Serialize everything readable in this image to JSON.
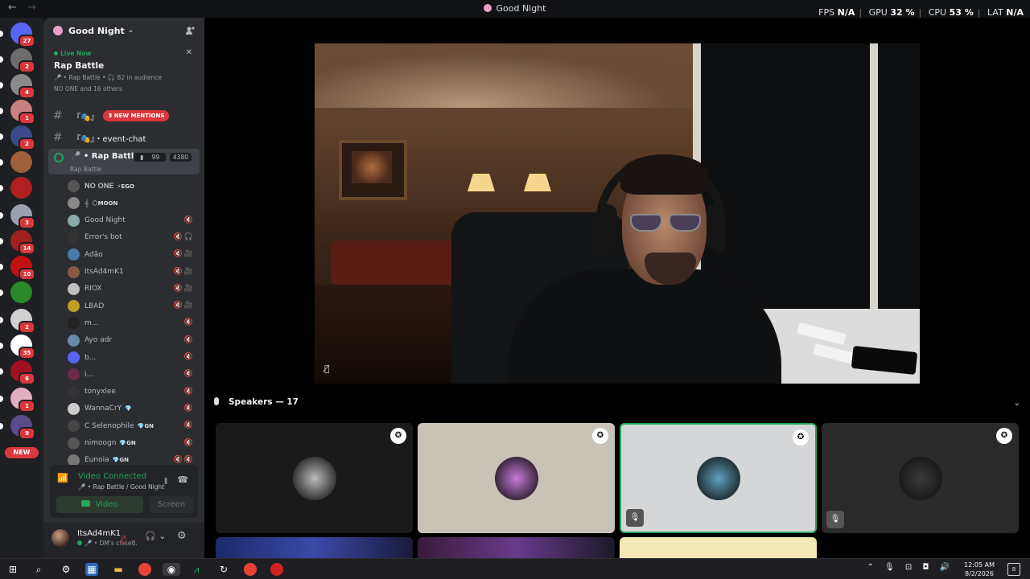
{
  "titlebar": {
    "title": "Good Night",
    "back": "←",
    "forward": "→"
  },
  "perf": {
    "fps_label": "FPS",
    "fps_value": "N/A",
    "gpu_label": "GPU",
    "gpu_value": "32 %",
    "cpu_label": "CPU",
    "cpu_value": "53 %",
    "lat_label": "LAT",
    "lat_value": "N/A",
    "separator": "|"
  },
  "rail": {
    "servers": [
      {
        "badge": "27",
        "color": "#5865f2"
      },
      {
        "badge": "2",
        "color": "#6d6d6d"
      },
      {
        "badge": "4",
        "color": "#8a8a8a"
      },
      {
        "badge": "1",
        "color": "#c98080"
      },
      {
        "badge": "2",
        "color": "#3a4a8a"
      },
      {
        "badge": "",
        "color": "#a0603a"
      },
      {
        "badge": "",
        "color": "#b02020"
      },
      {
        "badge": "3",
        "color": "#9aa0b0"
      },
      {
        "badge": "14",
        "color": "#a02020"
      },
      {
        "badge": "10",
        "color": "#c01010"
      },
      {
        "badge": "",
        "color": "#2a8a2a"
      },
      {
        "badge": "2",
        "color": "#d0d0d0"
      },
      {
        "badge": "35",
        "color": "#ffffff"
      },
      {
        "badge": "6",
        "color": "#a01020"
      },
      {
        "badge": "1",
        "color": "#e0b0c0"
      },
      {
        "badge": "9",
        "color": "#5a4a8a"
      }
    ],
    "new_label": "NEW"
  },
  "sidebar": {
    "server_name": "Good Night",
    "chevron": "⌄",
    "invite_icon": "add-member",
    "live": {
      "label": "Live Now",
      "title": "Rap Battle",
      "meta": "🎤 • Rap Battle • 🎧 82 in audience",
      "who": "NO ONE and 16 others"
    },
    "mentions_channel": {
      "name": "『🎭』",
      "badge": "3 NEW MENTIONS"
    },
    "event_channel": {
      "name": "『🎭』・event-chat"
    },
    "voice_channel": {
      "name": "🎤 • Rap Battle",
      "sub": "Rap Battle",
      "video_count": "99",
      "count": "4380"
    },
    "users": [
      {
        "name": "𝐍𝐎 𝐎𝐍𝐄",
        "tag": "⚡EGO",
        "color": "#555",
        "icons": ""
      },
      {
        "name": "𝄞",
        "tag": "🌕MOON",
        "color": "#888",
        "icons": ""
      },
      {
        "name": "Good Night",
        "tag": "",
        "color": "#8aa",
        "icons": "🔇"
      },
      {
        "name": "Error's bot",
        "tag": "",
        "color": "#333",
        "icons": "🔇🎧"
      },
      {
        "name": "Adão",
        "tag": "",
        "color": "#4a7aa8",
        "icons": "🔇🎥"
      },
      {
        "name": "ItsAd4mK1",
        "tag": "",
        "color": "#8a5a48",
        "icons": "🔇🎥"
      },
      {
        "name": "RIOX",
        "tag": "",
        "color": "#c0c0c0",
        "icons": "🔇🎥"
      },
      {
        "name": "LBAD",
        "tag": "",
        "color": "#c0a020",
        "icons": "🔇🎥"
      },
      {
        "name": "m...",
        "tag": "",
        "color": "#222",
        "icons": "🔇"
      },
      {
        "name": "Ayo adr",
        "tag": "",
        "color": "#6a8aaa",
        "icons": "🔇"
      },
      {
        "name": "b...",
        "tag": "",
        "color": "#5865f2",
        "icons": "🔇"
      },
      {
        "name": "i...",
        "tag": "",
        "color": "#6a2a4a",
        "icons": "🔇"
      },
      {
        "name": "tonyxlee",
        "tag": "",
        "color": "#333",
        "icons": "🔇"
      },
      {
        "name": "WannaCrY",
        "tag": "💎",
        "color": "#ccc",
        "icons": "🔇"
      },
      {
        "name": "C Selenophile",
        "tag": "💎GN",
        "color": "#444",
        "icons": "🔇"
      },
      {
        "name": "nimoogn",
        "tag": "💎GN",
        "color": "#555",
        "icons": "🔇"
      },
      {
        "name": "Eunoia",
        "tag": "💎GN",
        "color": "#777",
        "icons": "🔇🔇"
      }
    ],
    "video_connected": {
      "title": "Video Connected",
      "sub": "🎤 • Rap Battle / Good Night",
      "video_label": "Video",
      "screen_label": "Screen"
    },
    "panel": {
      "username": "ItsAd4mK1",
      "status": "🎤 • DM's closed."
    }
  },
  "main": {
    "speakers_label": "Speakers — 17",
    "tiles": [
      {
        "bg": "#1a1a1a",
        "avatar_bg": "#bbb",
        "border": "none",
        "mic_muted": false
      },
      {
        "bg": "#c8c3b6",
        "avatar_bg": "#c77ad8",
        "border": "none",
        "mic_muted": false
      },
      {
        "bg": "#d4d6d8",
        "avatar_bg": "#5fa2c0",
        "border": "2px solid #23a55a",
        "mic_muted": true
      },
      {
        "bg": "#2a2a2a",
        "avatar_bg": "#3a3a3a",
        "border": "none",
        "mic_muted": true
      }
    ]
  },
  "taskbar": {
    "time": "12:05 AM",
    "date": "8/2/2026",
    "notif_count": "8"
  }
}
